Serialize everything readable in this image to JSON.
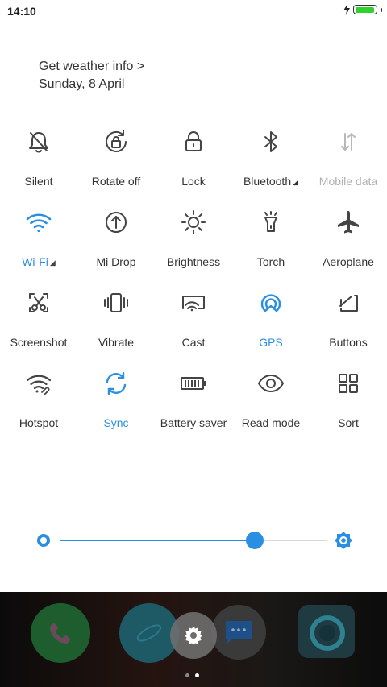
{
  "status_bar": {
    "time": "14:10"
  },
  "weather": {
    "line1": "Get weather info >",
    "line2": "Sunday, 8 April"
  },
  "toggles": [
    {
      "label": "Silent",
      "icon": "silent-icon",
      "state": "off"
    },
    {
      "label": "Rotate off",
      "icon": "rotate-off-icon",
      "state": "off"
    },
    {
      "label": "Lock",
      "icon": "lock-icon",
      "state": "off"
    },
    {
      "label": "Bluetooth",
      "icon": "bluetooth-icon",
      "state": "off"
    },
    {
      "label": "Mobile data",
      "icon": "mobile-data-icon",
      "state": "disabled"
    },
    {
      "label": "Wi-Fi",
      "icon": "wifi-icon",
      "state": "on"
    },
    {
      "label": "Mi Drop",
      "icon": "mi-drop-icon",
      "state": "off"
    },
    {
      "label": "Brightness",
      "icon": "brightness-icon",
      "state": "off"
    },
    {
      "label": "Torch",
      "icon": "torch-icon",
      "state": "off"
    },
    {
      "label": "Aeroplane",
      "icon": "aeroplane-icon",
      "state": "off"
    },
    {
      "label": "Screenshot",
      "icon": "screenshot-icon",
      "state": "off"
    },
    {
      "label": "Vibrate",
      "icon": "vibrate-icon",
      "state": "off"
    },
    {
      "label": "Cast",
      "icon": "cast-icon",
      "state": "off"
    },
    {
      "label": "GPS",
      "icon": "gps-icon",
      "state": "on"
    },
    {
      "label": "Buttons",
      "icon": "buttons-icon",
      "state": "off"
    },
    {
      "label": "Hotspot",
      "icon": "hotspot-icon",
      "state": "off"
    },
    {
      "label": "Sync",
      "icon": "sync-icon",
      "state": "on"
    },
    {
      "label": "Battery saver",
      "icon": "battery-saver-icon",
      "state": "off"
    },
    {
      "label": "Read mode",
      "icon": "read-mode-icon",
      "state": "off"
    },
    {
      "label": "Sort",
      "icon": "sort-icon",
      "state": "off"
    }
  ],
  "brightness": {
    "level": 0.73
  },
  "colors": {
    "accent": "#2a8fe2",
    "text": "#333333",
    "disabled": "#b0b0b0",
    "battery": "#2fd12f"
  },
  "dock": {
    "apps": [
      {
        "icon": "phone-icon",
        "color": "#1e5e2e"
      },
      {
        "icon": "browser-icon",
        "color": "#1d5a66"
      },
      {
        "icon": "messages-icon",
        "color": "#3a3a3a"
      },
      {
        "icon": "camera-icon",
        "color": "#1f5460"
      }
    ],
    "settings_icon": "gear-icon",
    "pages": 2,
    "current_page": 2
  }
}
